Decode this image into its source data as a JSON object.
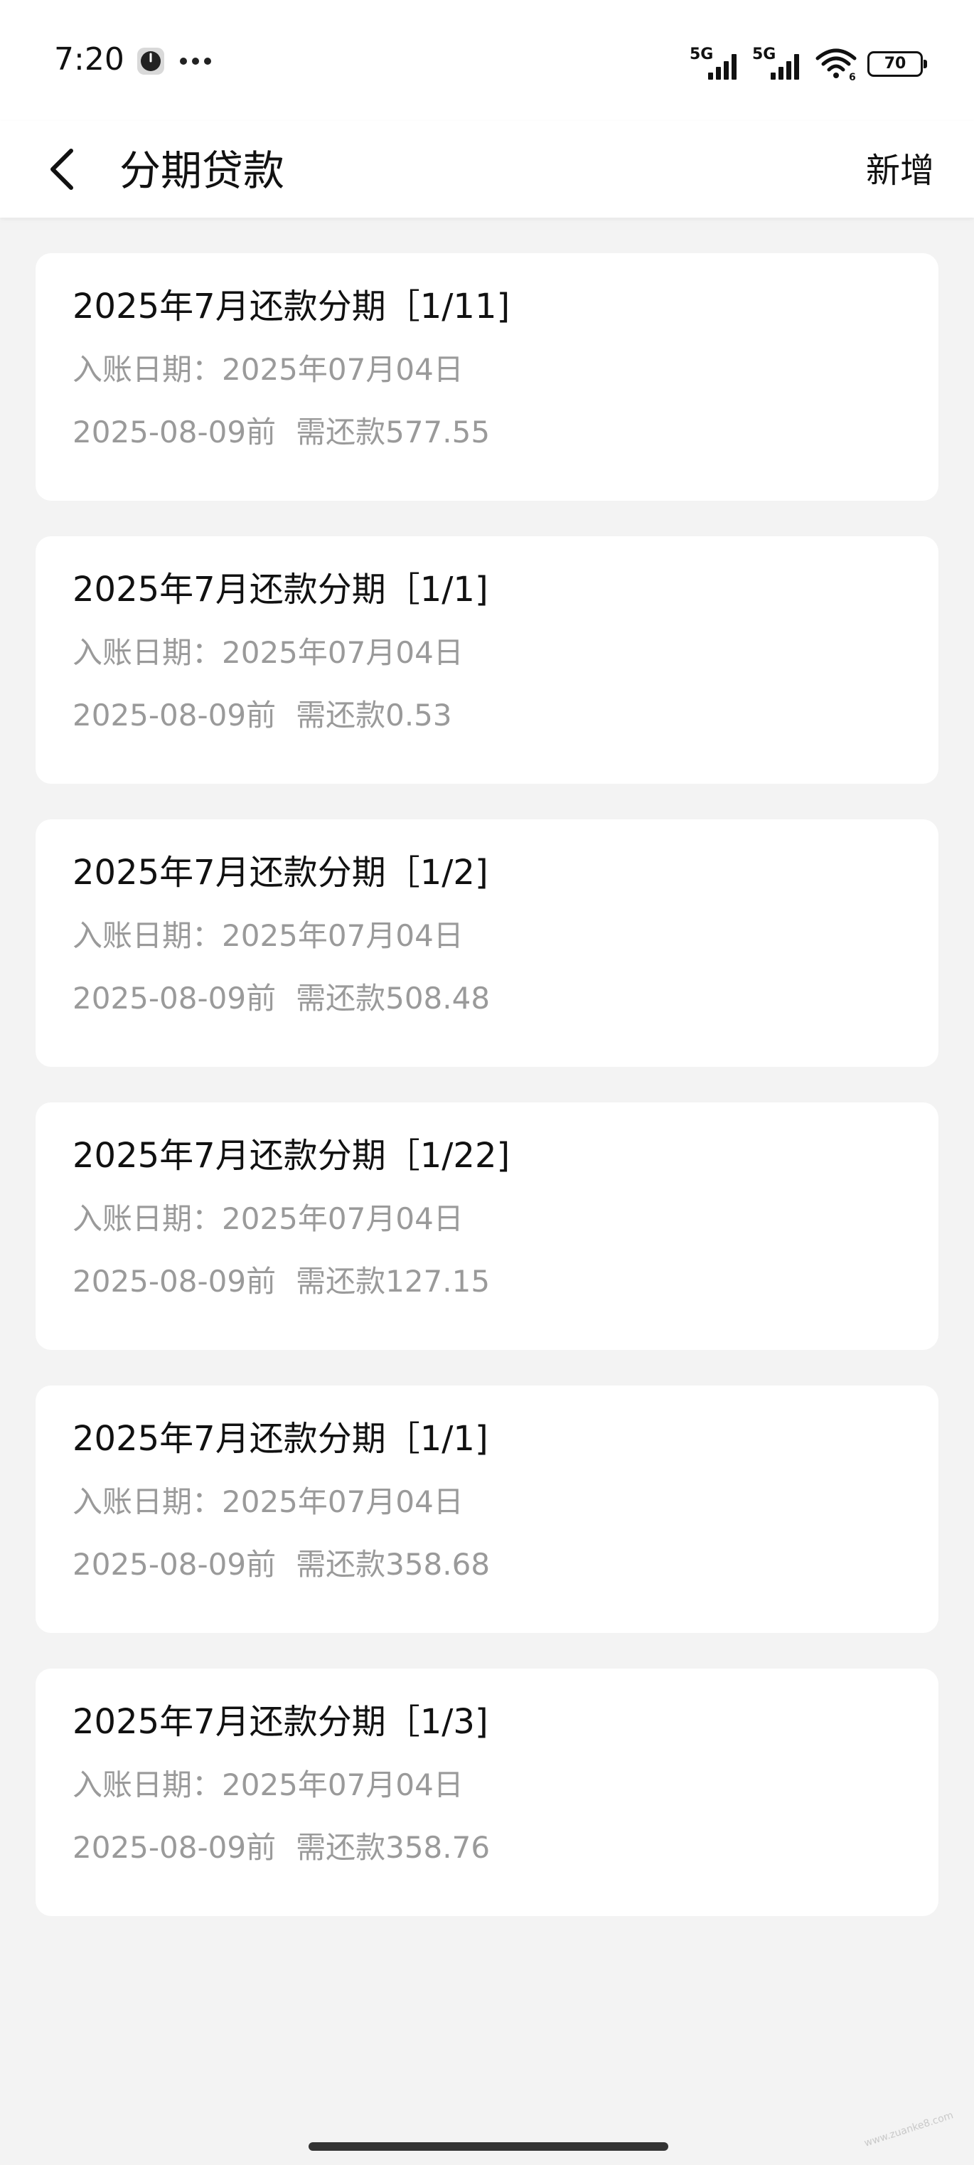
{
  "status_bar": {
    "time": "7:20",
    "signal_1": "5G",
    "signal_2": "5G",
    "wifi_badge": "6",
    "battery": "70"
  },
  "header": {
    "title": "分期贷款",
    "add_label": "新增"
  },
  "installments": [
    {
      "title": "2025年7月还款分期［1/11]",
      "posting_label": "入账日期：",
      "posting_date": "2025年07月04日",
      "due": "2025-08-09前",
      "amount_label": "需还款",
      "amount": "577.55"
    },
    {
      "title": "2025年7月还款分期［1/1]",
      "posting_label": "入账日期：",
      "posting_date": "2025年07月04日",
      "due": "2025-08-09前",
      "amount_label": "需还款",
      "amount": "0.53"
    },
    {
      "title": "2025年7月还款分期［1/2]",
      "posting_label": "入账日期：",
      "posting_date": "2025年07月04日",
      "due": "2025-08-09前",
      "amount_label": "需还款",
      "amount": "508.48"
    },
    {
      "title": "2025年7月还款分期［1/22]",
      "posting_label": "入账日期：",
      "posting_date": "2025年07月04日",
      "due": "2025-08-09前",
      "amount_label": "需还款",
      "amount": "127.15"
    },
    {
      "title": "2025年7月还款分期［1/1]",
      "posting_label": "入账日期：",
      "posting_date": "2025年07月04日",
      "due": "2025-08-09前",
      "amount_label": "需还款",
      "amount": "358.68"
    },
    {
      "title": "2025年7月还款分期［1/3]",
      "posting_label": "入账日期：",
      "posting_date": "2025年07月04日",
      "due": "2025-08-09前",
      "amount_label": "需还款",
      "amount": "358.76"
    }
  ],
  "watermark": "www.zuanke8.com"
}
